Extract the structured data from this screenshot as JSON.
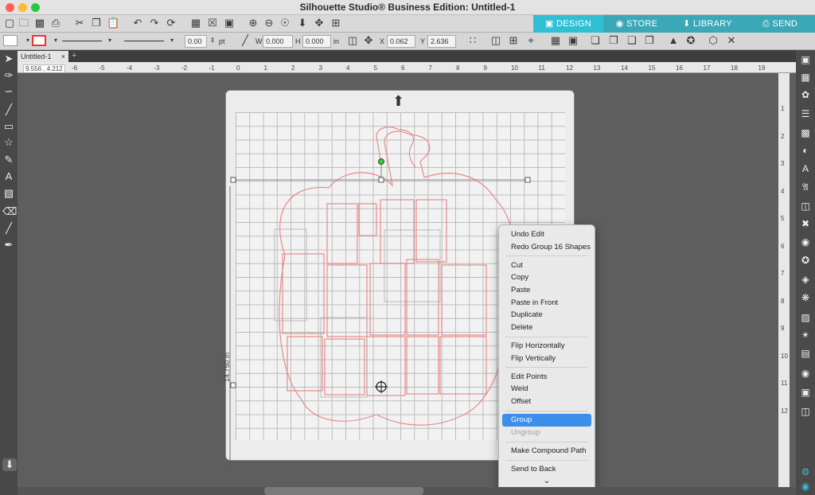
{
  "window": {
    "title": "Silhouette Studio® Business Edition: Untitled-1"
  },
  "tabs": {
    "design": "DESIGN",
    "store": "STORE",
    "library": "LIBRARY",
    "send": "SEND"
  },
  "toolbar2": {
    "line_width": "0.00",
    "line_unit": "pt",
    "w_label": "W",
    "w_value": "0.000",
    "h_label": "H",
    "h_value": "0.000",
    "h_unit": "in",
    "x_label": "X",
    "x_value": "0.062",
    "y_label": "Y",
    "y_value": "2.636"
  },
  "document": {
    "tab_label": "Untitled-1",
    "coords": "9.556 , 4.212",
    "dimension_label": "14.750 in"
  },
  "ruler_numbers": [
    "-6",
    "-5",
    "-4",
    "-3",
    "-2",
    "-1",
    "0",
    "1",
    "2",
    "3",
    "4",
    "5",
    "6",
    "7",
    "8",
    "9",
    "10",
    "11",
    "12",
    "13",
    "14",
    "15",
    "16",
    "17",
    "18",
    "19"
  ],
  "vruler_numbers": [
    "1",
    "2",
    "3",
    "4",
    "5",
    "6",
    "7",
    "8",
    "9",
    "10",
    "11",
    "12"
  ],
  "context_menu": {
    "items": [
      {
        "label": "Undo Edit"
      },
      {
        "label": "Redo Group 16 Shapes"
      },
      {
        "label": "Cut"
      },
      {
        "label": "Copy"
      },
      {
        "label": "Paste"
      },
      {
        "label": "Paste in Front"
      },
      {
        "label": "Duplicate"
      },
      {
        "label": "Delete"
      },
      {
        "label": "Flip Horizontally"
      },
      {
        "label": "Flip Vertically"
      },
      {
        "label": "Edit Points"
      },
      {
        "label": "Weld"
      },
      {
        "label": "Offset"
      },
      {
        "label": "Group"
      },
      {
        "label": "Ungroup"
      },
      {
        "label": "Make Compound Path"
      },
      {
        "label": "Send to Back"
      }
    ],
    "more_icon": "chevron-down-icon"
  },
  "colors": {
    "accent": "#2fc0d3",
    "design_outline": "#e88a8a",
    "menu_highlight": "#3d8ee8"
  }
}
